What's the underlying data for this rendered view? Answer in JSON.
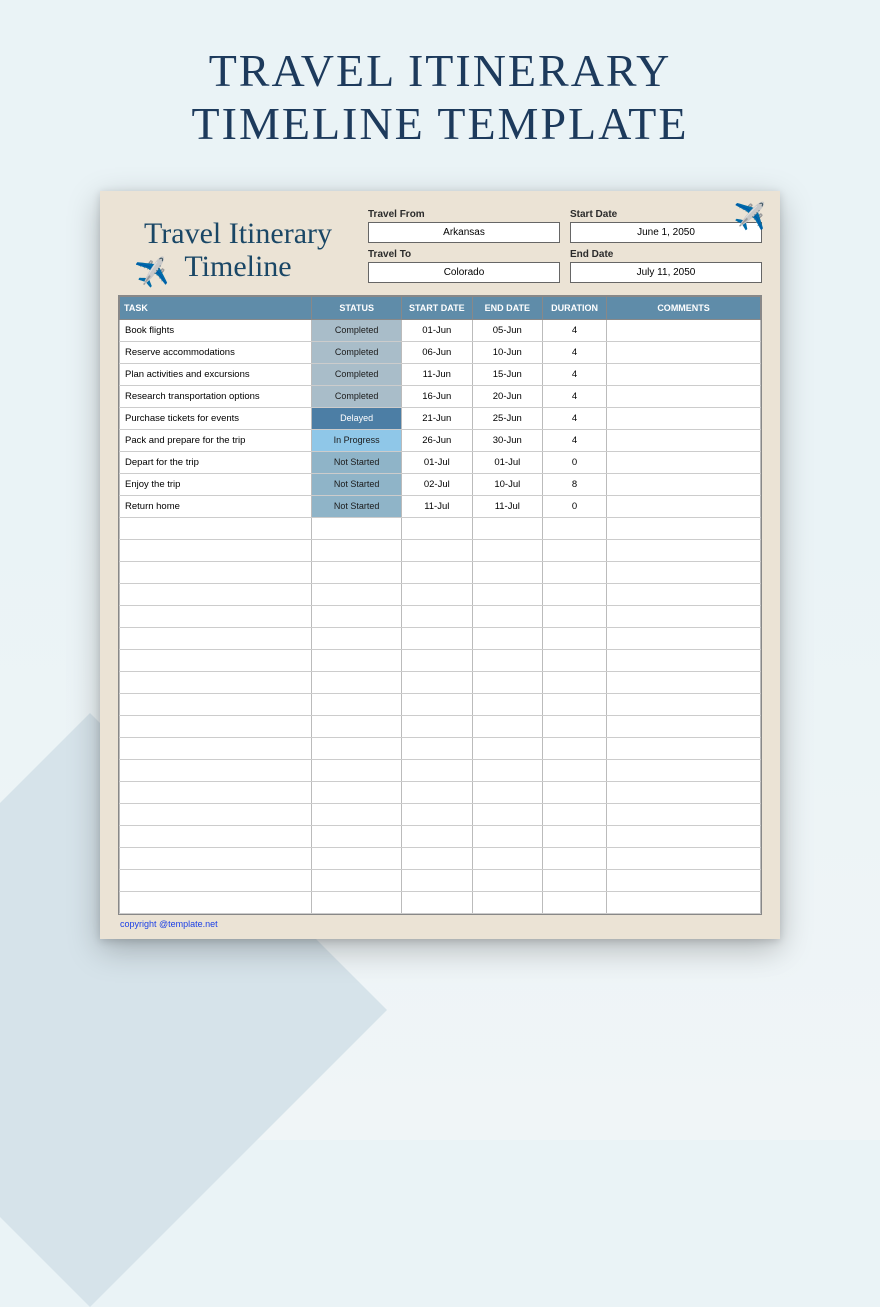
{
  "page_title_line1": "TRAVEL ITINERARY",
  "page_title_line2": "TIMELINE TEMPLATE",
  "script_title_line1": "Travel Itinerary",
  "script_title_line2": "Timeline",
  "meta": {
    "travel_from_label": "Travel From",
    "travel_from_value": "Arkansas",
    "start_date_label": "Start Date",
    "start_date_value": "June 1, 2050",
    "travel_to_label": "Travel To",
    "travel_to_value": "Colorado",
    "end_date_label": "End Date",
    "end_date_value": "July 11, 2050"
  },
  "columns": {
    "task": "TASK",
    "status": "STATUS",
    "start": "START DATE",
    "end": "END DATE",
    "duration": "DURATION",
    "comments": "COMMENTS"
  },
  "rows": [
    {
      "task": "Book flights",
      "status": "Completed",
      "status_class": "s-completed",
      "start": "01-Jun",
      "end": "05-Jun",
      "duration": "4",
      "comments": ""
    },
    {
      "task": "Reserve accommodations",
      "status": "Completed",
      "status_class": "s-completed",
      "start": "06-Jun",
      "end": "10-Jun",
      "duration": "4",
      "comments": ""
    },
    {
      "task": "Plan activities and excursions",
      "status": "Completed",
      "status_class": "s-completed",
      "start": "11-Jun",
      "end": "15-Jun",
      "duration": "4",
      "comments": ""
    },
    {
      "task": "Research transportation options",
      "status": "Completed",
      "status_class": "s-completed",
      "start": "16-Jun",
      "end": "20-Jun",
      "duration": "4",
      "comments": ""
    },
    {
      "task": "Purchase tickets for events",
      "status": "Delayed",
      "status_class": "s-delayed",
      "start": "21-Jun",
      "end": "25-Jun",
      "duration": "4",
      "comments": ""
    },
    {
      "task": "Pack and prepare for the trip",
      "status": "In Progress",
      "status_class": "s-inprogress",
      "start": "26-Jun",
      "end": "30-Jun",
      "duration": "4",
      "comments": ""
    },
    {
      "task": "Depart for the trip",
      "status": "Not Started",
      "status_class": "s-notstarted",
      "start": "01-Jul",
      "end": "01-Jul",
      "duration": "0",
      "comments": ""
    },
    {
      "task": "Enjoy the trip",
      "status": "Not Started",
      "status_class": "s-notstarted",
      "start": "02-Jul",
      "end": "10-Jul",
      "duration": "8",
      "comments": ""
    },
    {
      "task": "Return home",
      "status": "Not Started",
      "status_class": "s-notstarted",
      "start": "11-Jul",
      "end": "11-Jul",
      "duration": "0",
      "comments": ""
    }
  ],
  "empty_rows": 18,
  "copyright": "copyright @template.net",
  "icons": {
    "airplane": "✈️"
  }
}
